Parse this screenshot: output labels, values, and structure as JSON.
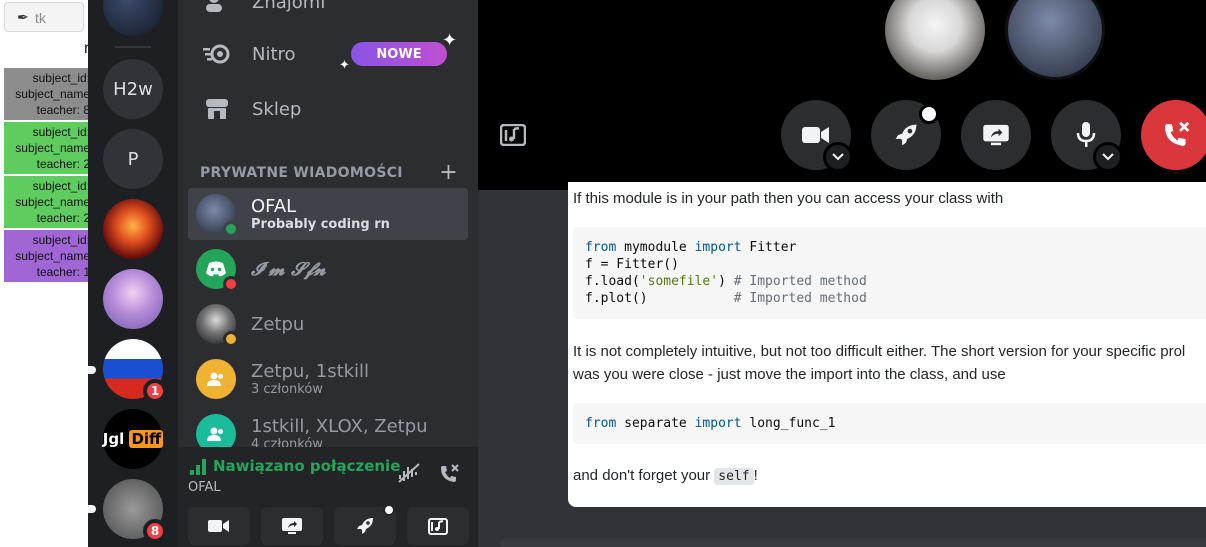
{
  "left_app": {
    "search_value": "tk",
    "r_fragment": "r",
    "subjects": [
      {
        "id": "subject_id:",
        "name": "subject_name",
        "teacher": "teacher: 8",
        "color": "#8c8c8c"
      },
      {
        "id": "subject_id:",
        "name": "subject_name",
        "teacher": "teacher: 2",
        "color": "#5fcc5f"
      },
      {
        "id": "subject_id:",
        "name": "subject_name",
        "teacher": "teacher: 2",
        "color": "#5fcc5f"
      },
      {
        "id": "subject_id:",
        "name": "subject_name",
        "teacher": "teacher: 1",
        "color": "#a066d6"
      }
    ]
  },
  "servers": {
    "items": [
      {
        "label": "H2w"
      },
      {
        "label": "P"
      },
      {
        "label": ""
      },
      {
        "label": ""
      },
      {
        "label": "",
        "badge": "1"
      },
      {
        "label": "Jgl Diff"
      },
      {
        "label": "",
        "badge": "8"
      }
    ]
  },
  "channels": {
    "nav": {
      "friends": "Znajomi",
      "nitro": "Nitro",
      "nitro_badge": "NOWE",
      "shop": "Sklep"
    },
    "dm_header": "PRYWATNE WIADOMOŚCI",
    "dm_add": "+",
    "dms": [
      {
        "name": "OFAL",
        "sub": "Probably coding rn"
      },
      {
        "name": "𝓘'𝓶 𝓢𝓯𝓷",
        "sub": ""
      },
      {
        "name": "Zetpu",
        "sub": ""
      },
      {
        "name": "Zetpu, 1stkill",
        "sub": "3 członków"
      },
      {
        "name": "1stkill, XLOX, Zetpu",
        "sub": "4 członków"
      }
    ],
    "voice": {
      "status": "Nawiązano połączenie",
      "channel": "OFAL"
    }
  },
  "answer": {
    "p1": "If this module is in your path then you can access your class with",
    "code1": [
      [
        {
          "t": "from",
          "c": "kw"
        },
        {
          "t": " mymodule ",
          "c": ""
        },
        {
          "t": "import",
          "c": "kw"
        },
        {
          "t": " Fitter",
          "c": ""
        }
      ],
      [
        {
          "t": "f = Fitter()",
          "c": ""
        }
      ],
      [
        {
          "t": "f.load(",
          "c": ""
        },
        {
          "t": "'somefile'",
          "c": "str"
        },
        {
          "t": ") ",
          "c": ""
        },
        {
          "t": "# Imported method",
          "c": "cm"
        }
      ],
      [
        {
          "t": "f.plot()           ",
          "c": ""
        },
        {
          "t": "# Imported method",
          "c": "cm"
        }
      ]
    ],
    "p2a": "It is not completely intuitive, but not too difficult either. The short version for your specific prol",
    "p2b": "was you were close - just move the import into the class, and use",
    "code2": [
      [
        {
          "t": "from",
          "c": "kw"
        },
        {
          "t": " separate ",
          "c": ""
        },
        {
          "t": "import",
          "c": "kw"
        },
        {
          "t": " long_func_1",
          "c": ""
        }
      ]
    ],
    "p3_before": "and don't forget your ",
    "p3_code": "self",
    "p3_after": "!"
  }
}
